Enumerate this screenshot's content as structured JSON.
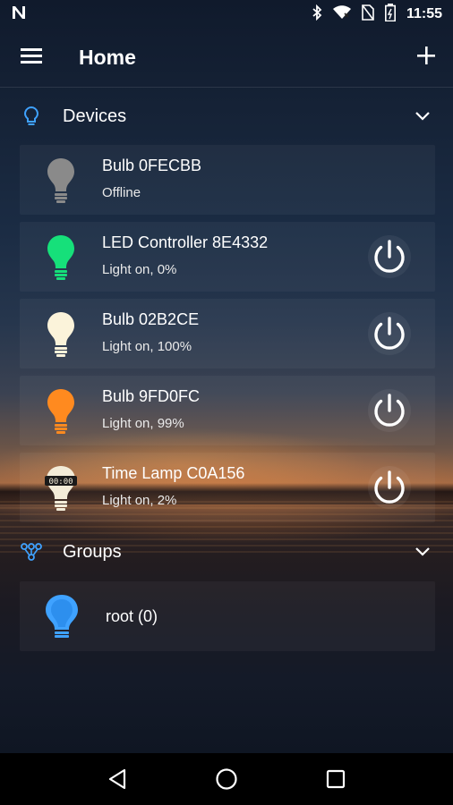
{
  "status_bar": {
    "left_icon": "n-notification-icon",
    "icons": [
      "bluetooth-icon",
      "wifi-icon",
      "no-sim-icon",
      "battery-icon"
    ],
    "time": "11:55"
  },
  "app_bar": {
    "menu_icon": "menu-icon",
    "title": "Home",
    "add_icon": "plus-icon"
  },
  "devices_section": {
    "icon": "lightbulb-outline-icon",
    "label": "Devices",
    "chevron": "chevron-down-icon",
    "items": [
      {
        "name": "Bulb 0FECBB",
        "status": "Offline",
        "icon": "bulb-icon",
        "color": "#8a8a8a",
        "power_button": false
      },
      {
        "name": "LED Controller 8E4332",
        "status": "Light on, 0%",
        "icon": "bulb-icon",
        "color": "#16e07a",
        "power_button": true
      },
      {
        "name": "Bulb 02B2CE",
        "status": "Light on, 100%",
        "icon": "bulb-icon",
        "color": "#fbf3da",
        "power_button": true
      },
      {
        "name": "Bulb 9FD0FC",
        "status": "Light on, 99%",
        "icon": "bulb-icon",
        "color": "#ff8a1f",
        "power_button": true
      },
      {
        "name": "Time Lamp C0A156",
        "status": "Light on, 2%",
        "icon": "time-lamp-icon",
        "color": "#f3ecd8",
        "power_button": true
      }
    ]
  },
  "groups_section": {
    "icon": "group-tree-icon",
    "label": "Groups",
    "chevron": "chevron-down-icon",
    "items": [
      {
        "name": "root (0)",
        "icon": "bulb-outline-icon",
        "color": "#3fa2ff"
      }
    ]
  },
  "nav_bar": {
    "back_icon": "back-triangle-icon",
    "home_icon": "home-circle-icon",
    "recents_icon": "recents-square-icon"
  },
  "colors": {
    "accent_blue": "#3fa2ff",
    "power_ring": "#ffffff"
  }
}
